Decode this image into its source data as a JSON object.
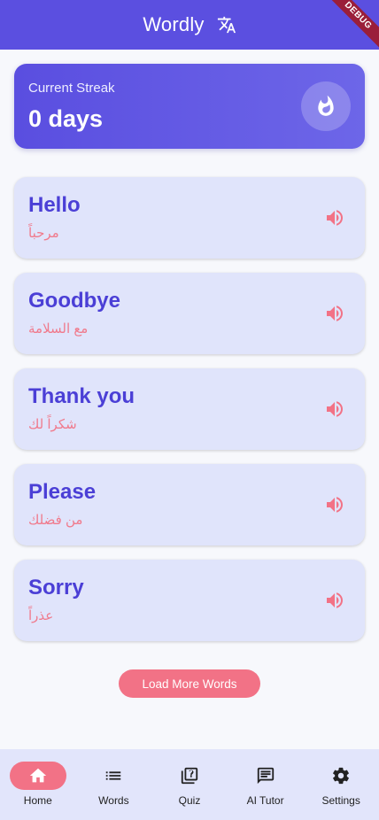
{
  "appbar": {
    "title": "Wordly",
    "debug_label": "DEBUG"
  },
  "streak": {
    "label": "Current Streak",
    "value": "0 days"
  },
  "words": [
    {
      "english": "Hello",
      "arabic": "مرحباً"
    },
    {
      "english": "Goodbye",
      "arabic": "مع السلامة"
    },
    {
      "english": "Thank you",
      "arabic": "شكراً لك"
    },
    {
      "english": "Please",
      "arabic": "من فضلك"
    },
    {
      "english": "Sorry",
      "arabic": "عذراً"
    }
  ],
  "load_more_label": "Load More Words",
  "nav": [
    {
      "label": "Home",
      "icon": "home-icon",
      "active": true
    },
    {
      "label": "Words",
      "icon": "list-icon",
      "active": false
    },
    {
      "label": "Quiz",
      "icon": "quiz-icon",
      "active": false
    },
    {
      "label": "AI Tutor",
      "icon": "chat-icon",
      "active": false
    },
    {
      "label": "Settings",
      "icon": "gear-icon",
      "active": false
    }
  ],
  "colors": {
    "primary": "#5b4fe0",
    "accent": "#f27286",
    "card": "#e0e4fb",
    "nav_bg": "#e2e5fb"
  }
}
